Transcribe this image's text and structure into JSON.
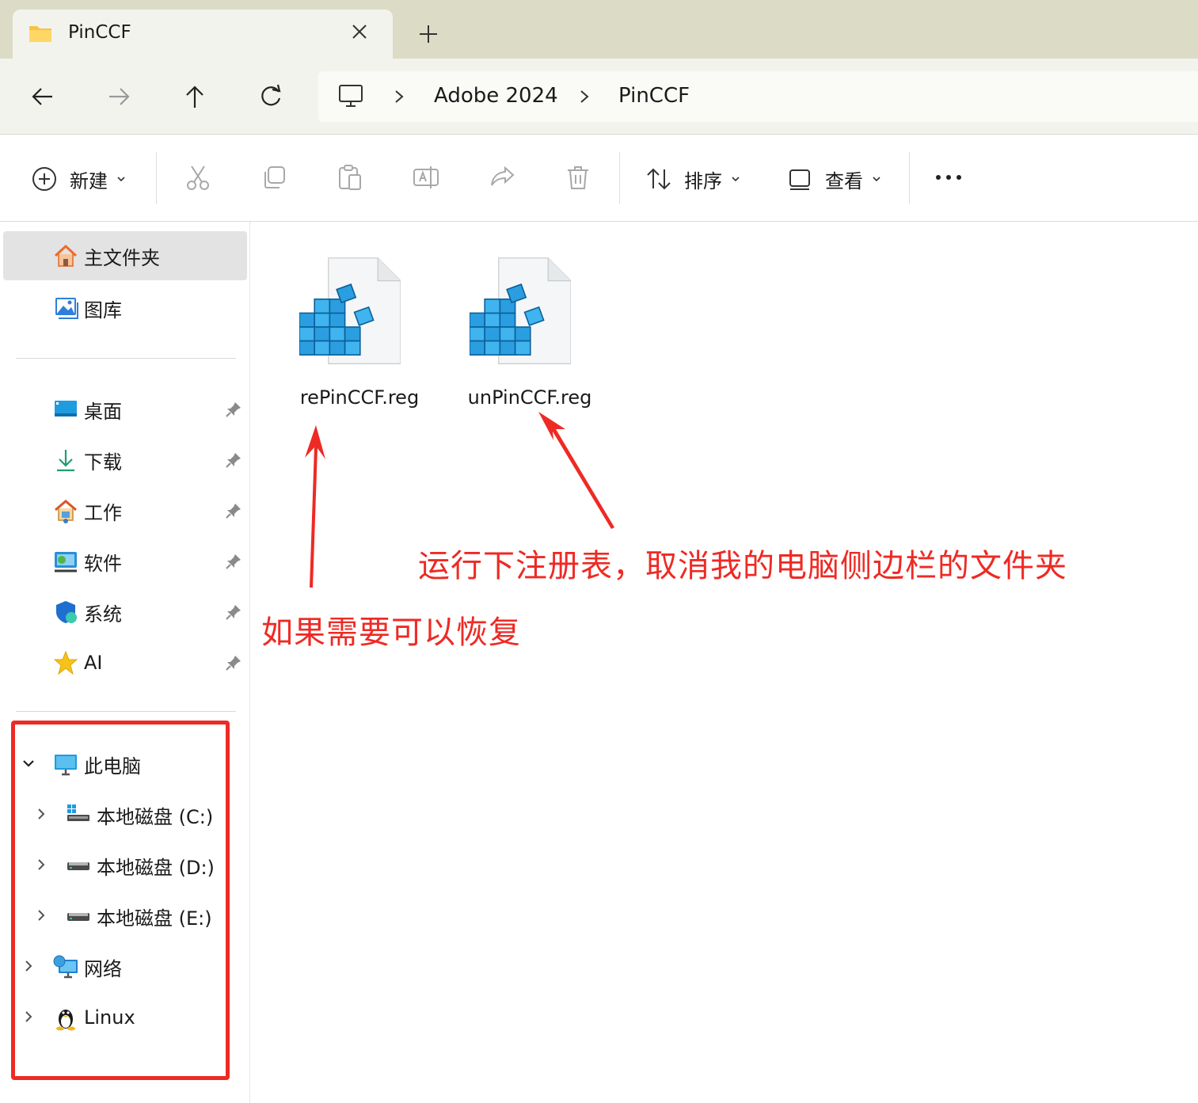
{
  "tab": {
    "title": "PinCCF",
    "icon": "folder-icon",
    "close_icon": "close-icon",
    "new_tab_icon": "plus-icon"
  },
  "navigation": {
    "back_icon": "arrow-left-icon",
    "forward_icon": "arrow-right-icon",
    "up_icon": "arrow-up-icon",
    "refresh_icon": "refresh-icon",
    "breadcrumb": [
      "Adobe 2024",
      "PinCCF"
    ],
    "root_icon": "computer-icon"
  },
  "toolbar": {
    "new_label": "新建",
    "sort_label": "排序",
    "view_label": "查看",
    "actions": [
      "cut-icon",
      "copy-icon",
      "paste-icon",
      "rename-icon",
      "share-icon",
      "delete-icon"
    ],
    "more_icon": "more-icon"
  },
  "sidebar": {
    "top": [
      {
        "label": "主文件夹",
        "icon": "home-icon",
        "selected": true
      },
      {
        "label": "图库",
        "icon": "gallery-icon",
        "selected": false
      }
    ],
    "quick_access": [
      {
        "label": "桌面",
        "icon": "desktop-icon"
      },
      {
        "label": "下载",
        "icon": "download-icon"
      },
      {
        "label": "工作",
        "icon": "work-folder-icon"
      },
      {
        "label": "软件",
        "icon": "software-folder-icon"
      },
      {
        "label": "系统",
        "icon": "system-shield-icon"
      },
      {
        "label": "AI",
        "icon": "star-icon"
      }
    ],
    "this_pc": {
      "label": "此电脑",
      "icon": "monitor-icon",
      "drives": [
        {
          "label": "本地磁盘 (C:)",
          "icon": "system-drive-icon"
        },
        {
          "label": "本地磁盘 (D:)",
          "icon": "drive-icon"
        },
        {
          "label": "本地磁盘 (E:)",
          "icon": "drive-icon"
        }
      ]
    },
    "network": {
      "label": "网络",
      "icon": "network-icon"
    },
    "linux": {
      "label": "Linux",
      "icon": "linux-penguin-icon"
    }
  },
  "files": [
    {
      "name": "rePinCCF.reg",
      "icon": "registry-file-icon"
    },
    {
      "name": "unPinCCF.reg",
      "icon": "registry-file-icon"
    }
  ],
  "annotations": {
    "right_note": "运行下注册表，取消我的电脑侧边栏的文件夹",
    "left_note": "如果需要可以恢复",
    "color": "#ee2a24"
  }
}
